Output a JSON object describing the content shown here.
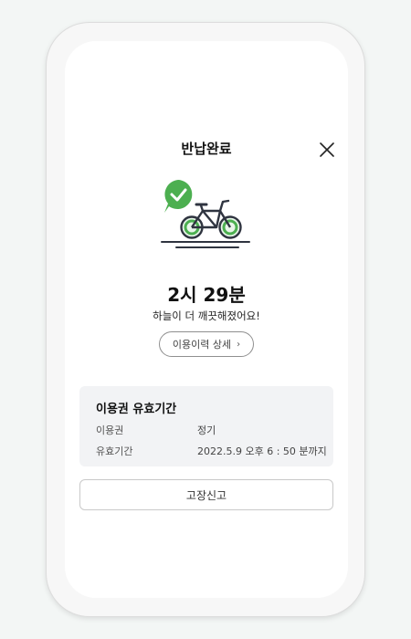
{
  "header": {
    "title": "반납완료",
    "close_icon": "close-icon"
  },
  "illustration": {
    "icon": "bicycle-icon",
    "badge_icon": "check-icon",
    "accent_color": "#4caf50"
  },
  "summary": {
    "duration": "2시 29분",
    "message": "하늘이 더 깨끗해졌어요!",
    "history_button_label": "이용이력 상세",
    "history_button_icon": "chevron-right-icon"
  },
  "ticket": {
    "title": "이용권 유효기간",
    "rows": [
      {
        "label": "이용권",
        "value": "정기"
      },
      {
        "label": "유효기간",
        "value": "2022.5.9 오후 6 : 50 분까지"
      }
    ]
  },
  "footer": {
    "report_button_label": "고장신고"
  }
}
